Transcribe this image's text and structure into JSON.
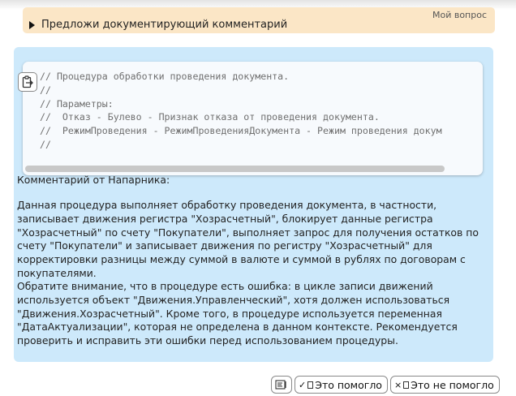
{
  "question": {
    "badge": "Мой вопрос",
    "text": "Предложи документирующий комментарий"
  },
  "code": {
    "lines": [
      "// Процедура обработки проведения документа.",
      "//",
      "// Параметры:",
      "//  Отказ - Булево - Признак отказа от проведения документа.",
      "//  РежимПроведения - РежимПроведенияДокумента - Режим проведения докум",
      "//"
    ]
  },
  "answer": {
    "heading": "Комментарий от Напарника:",
    "paragraph1": "Данная процедура выполняет обработку проведения документа, в частности, записывает движения регистра \"Хозрасчетный\", блокирует данные регистра \"Хозрасчетный\" по счету \"Покупатели\", выполняет запрос для получения остатков по счету \"Покупатели\" и записывает движения по регистру \"Хозрасчетный\" для корректировки разницы между суммой в валюте и суммой в рублях по договорам с покупателями.",
    "paragraph2": "Обратите внимание, что в процедуре есть ошибка: в цикле записи движений используется объект \"Движения.Управленческий\", хотя должен использоваться \"Движения.Хозрасчетный\". Кроме того, в процедуре используется переменная \"ДатаАктуализации\", которая не определена в данном контексте. Рекомендуется проверить и исправить эти ошибки перед использованием процедуры."
  },
  "feedback": {
    "helped_label": "Это помогло",
    "not_helped_label": "Это не помогло"
  },
  "icons": {
    "copy": "clipboard-icon",
    "expand": "triangle-right-icon",
    "insert": "insert-doc-icon",
    "check": "check-icon",
    "cross": "cross-icon"
  }
}
